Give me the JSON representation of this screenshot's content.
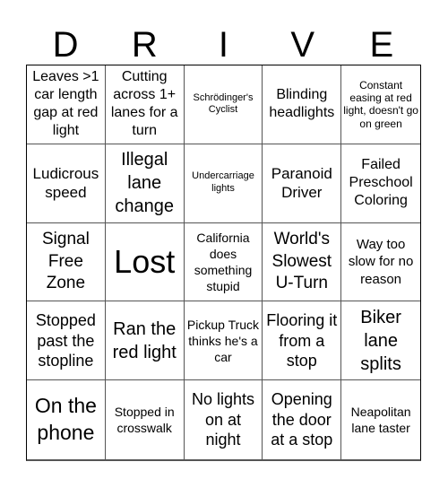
{
  "title_letters": [
    "D",
    "R",
    "I",
    "V",
    "E"
  ],
  "cells": [
    [
      "Leaves >1 car length gap at red light",
      "Cutting across 1+ lanes for a turn",
      "Schrödinger's Cyclist",
      "Blinding headlights",
      "Constant easing at red light, doesn't go on green"
    ],
    [
      "Ludicrous speed",
      "Illegal lane change",
      "Undercarriage lights",
      "Paranoid Driver",
      "Failed Preschool Coloring"
    ],
    [
      "Signal Free Zone",
      "Lost",
      "California does something stupid",
      "World's Slowest U-Turn",
      "Way too slow for no reason"
    ],
    [
      "Stopped past the stopline",
      "Ran the red light",
      "Pickup Truck thinks he's a car",
      "Flooring it from a stop",
      "Biker lane splits"
    ],
    [
      "On the phone",
      "Stopped in crosswalk",
      "No lights on at night",
      "Opening the door at a stop",
      "Neapolitan lane taster"
    ]
  ]
}
